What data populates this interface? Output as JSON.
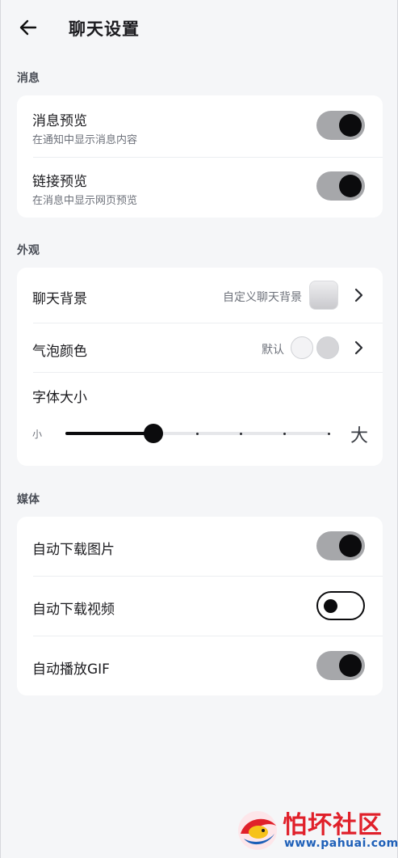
{
  "header": {
    "title": "聊天设置",
    "back_icon": "arrow-left-icon"
  },
  "sections": {
    "messages": {
      "label": "消息",
      "message_preview": {
        "title": "消息预览",
        "subtitle": "在通知中显示消息内容",
        "enabled": true
      },
      "link_preview": {
        "title": "链接预览",
        "subtitle": "在消息中显示网页预览",
        "enabled": true
      }
    },
    "appearance": {
      "label": "外观",
      "chat_background": {
        "title": "聊天背景",
        "value": "自定义聊天背景"
      },
      "bubble_color": {
        "title": "气泡颜色",
        "value": "默认",
        "colors": [
          "#f3f3f5",
          "#d5d5d8"
        ]
      },
      "font_size": {
        "title": "字体大小",
        "small_label": "小",
        "large_label": "大",
        "steps": 7,
        "selected_step": 2
      }
    },
    "media": {
      "label": "媒体",
      "auto_download_images": {
        "title": "自动下载图片",
        "enabled": true
      },
      "auto_download_videos": {
        "title": "自动下载视频",
        "enabled": false
      },
      "autoplay_gif": {
        "title": "自动播放GIF",
        "enabled": true
      }
    }
  },
  "watermark": {
    "text": "怕坏社区",
    "url": "www.pahuai.com"
  },
  "colors": {
    "background": "#f5f6f8",
    "card": "#ffffff",
    "toggle_on_track": "#a6a7aa",
    "toggle_knob": "#0b0b0d",
    "watermark_red": "#e0202a",
    "watermark_blue": "#1d5fb8"
  }
}
